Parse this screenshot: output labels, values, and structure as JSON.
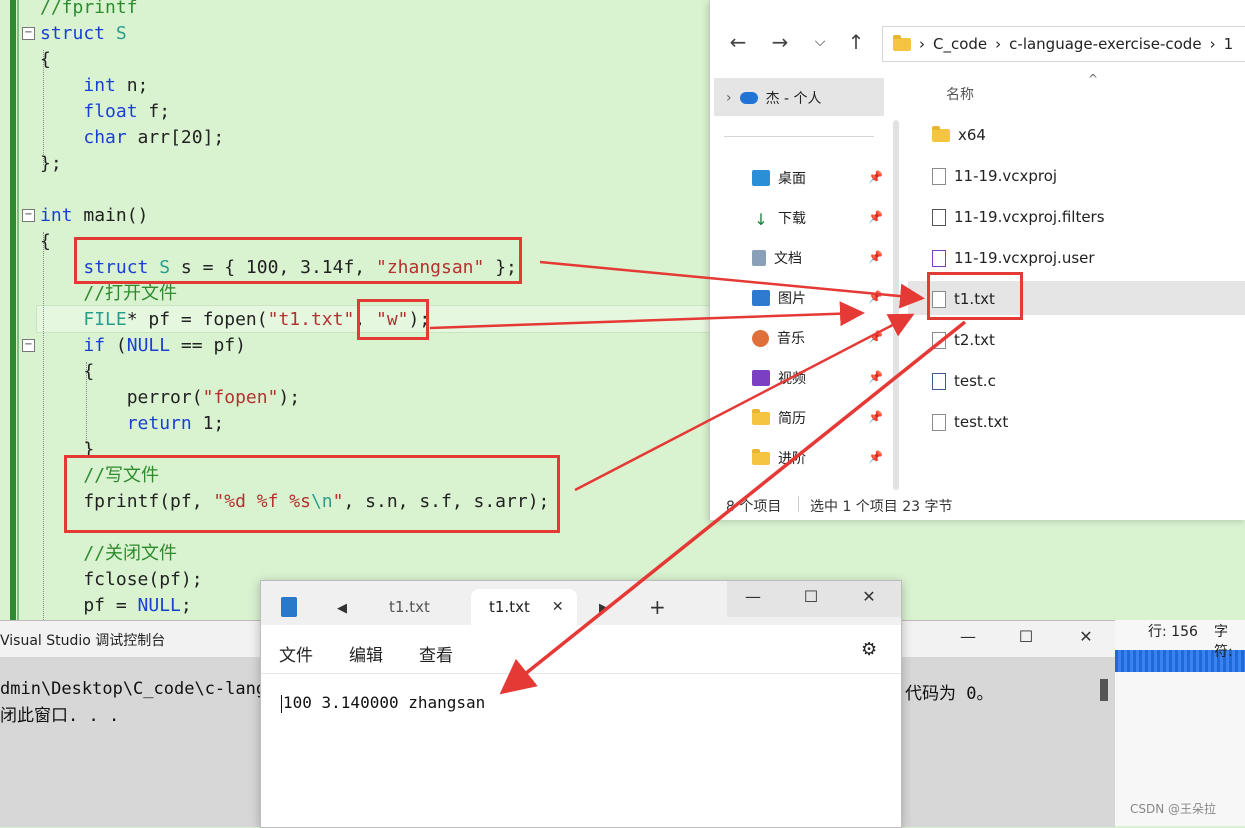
{
  "code": {
    "lines": [
      {
        "parts": [
          {
            "t": "//fprintf",
            "c": "cm"
          }
        ]
      },
      {
        "parts": [
          {
            "t": "struct",
            "c": "kw"
          },
          {
            "t": " S",
            "c": "ty"
          }
        ]
      },
      {
        "parts": [
          {
            "t": "{",
            "c": "nm"
          }
        ]
      },
      {
        "parts": [
          {
            "t": "    ",
            "c": "nm"
          },
          {
            "t": "int",
            "c": "kw"
          },
          {
            "t": " n;",
            "c": "nm"
          }
        ]
      },
      {
        "parts": [
          {
            "t": "    ",
            "c": "nm"
          },
          {
            "t": "float",
            "c": "kw"
          },
          {
            "t": " f;",
            "c": "nm"
          }
        ]
      },
      {
        "parts": [
          {
            "t": "    ",
            "c": "nm"
          },
          {
            "t": "char",
            "c": "kw"
          },
          {
            "t": " arr[20];",
            "c": "nm"
          }
        ]
      },
      {
        "parts": [
          {
            "t": "};",
            "c": "nm"
          }
        ]
      },
      {
        "parts": [
          {
            "t": "",
            "c": "nm"
          }
        ]
      },
      {
        "parts": [
          {
            "t": "int",
            "c": "kw"
          },
          {
            "t": " main()",
            "c": "nm"
          }
        ]
      },
      {
        "parts": [
          {
            "t": "{",
            "c": "nm"
          }
        ]
      },
      {
        "parts": [
          {
            "t": "    ",
            "c": "nm"
          },
          {
            "t": "struct",
            "c": "kw"
          },
          {
            "t": " S",
            "c": "ty"
          },
          {
            "t": " s = { 100, 3.14f, ",
            "c": "nm"
          },
          {
            "t": "\"zhangsan\"",
            "c": "st"
          },
          {
            "t": " };",
            "c": "nm"
          }
        ]
      },
      {
        "parts": [
          {
            "t": "    ",
            "c": "nm"
          },
          {
            "t": "//打开文件",
            "c": "cm"
          }
        ]
      },
      {
        "parts": [
          {
            "t": "    ",
            "c": "nm"
          },
          {
            "t": "FILE",
            "c": "ty"
          },
          {
            "t": "* pf = fopen(",
            "c": "nm"
          },
          {
            "t": "\"t1.txt\"",
            "c": "st"
          },
          {
            "t": ", ",
            "c": "nm"
          },
          {
            "t": "\"w\"",
            "c": "st"
          },
          {
            "t": ");",
            "c": "nm"
          }
        ]
      },
      {
        "parts": [
          {
            "t": "    ",
            "c": "nm"
          },
          {
            "t": "if",
            "c": "kw"
          },
          {
            "t": " (",
            "c": "nm"
          },
          {
            "t": "NULL",
            "c": "kw"
          },
          {
            "t": " == pf)",
            "c": "nm"
          }
        ]
      },
      {
        "parts": [
          {
            "t": "    {",
            "c": "nm"
          }
        ]
      },
      {
        "parts": [
          {
            "t": "        perror(",
            "c": "nm"
          },
          {
            "t": "\"fopen\"",
            "c": "st"
          },
          {
            "t": ");",
            "c": "nm"
          }
        ]
      },
      {
        "parts": [
          {
            "t": "        ",
            "c": "nm"
          },
          {
            "t": "return",
            "c": "kw"
          },
          {
            "t": " 1;",
            "c": "nm"
          }
        ]
      },
      {
        "parts": [
          {
            "t": "    }",
            "c": "nm"
          }
        ]
      },
      {
        "parts": [
          {
            "t": "    ",
            "c": "nm"
          },
          {
            "t": "//写文件",
            "c": "cm"
          }
        ]
      },
      {
        "parts": [
          {
            "t": "    fprintf(pf, ",
            "c": "nm"
          },
          {
            "t": "\"%d %f %s",
            "c": "st"
          },
          {
            "t": "\\n",
            "c": "ty"
          },
          {
            "t": "\"",
            "c": "st"
          },
          {
            "t": ", s.n, s.f, s.arr);",
            "c": "nm"
          }
        ]
      },
      {
        "parts": [
          {
            "t": "",
            "c": "nm"
          }
        ]
      },
      {
        "parts": [
          {
            "t": "    ",
            "c": "nm"
          },
          {
            "t": "//关闭文件",
            "c": "cm"
          }
        ]
      },
      {
        "parts": [
          {
            "t": "    fclose(pf);",
            "c": "nm"
          }
        ]
      },
      {
        "parts": [
          {
            "t": "    pf = ",
            "c": "nm"
          },
          {
            "t": "NULL",
            "c": "kw"
          },
          {
            "t": ";",
            "c": "nm"
          }
        ]
      }
    ]
  },
  "explorer": {
    "path": [
      "C_code",
      "c-language-exercise-code",
      "1"
    ],
    "sidebar_top": "杰 - 个人",
    "sidebar": [
      "桌面",
      "下载",
      "文档",
      "图片",
      "音乐",
      "视频",
      "简历",
      "进阶"
    ],
    "column_header": "名称",
    "files": [
      "x64",
      "11-19.vcxproj",
      "11-19.vcxproj.filters",
      "11-19.vcxproj.user",
      "t1.txt",
      "t2.txt",
      "test.c",
      "test.txt"
    ],
    "status_count": "8 个项目",
    "status_selected": "选中 1 个项目  23 字节",
    "colors": {
      "selection": "#e5e5e5",
      "annotation": "#e53935"
    }
  },
  "console": {
    "title": "Visual Studio 调试控制台",
    "line1": "dmin\\Desktop\\C_code\\c-langu",
    "line1_right": "代码为 0。",
    "line2": "闭此窗口. . ."
  },
  "statusbar": {
    "line": "行: 156",
    "char": "字符:"
  },
  "notepad": {
    "tab1": "t1.txt",
    "tab2": "t1.txt",
    "menu": [
      "文件",
      "编辑",
      "查看"
    ],
    "content": "100 3.140000 zhangsan"
  },
  "watermark": "CSDN @王朵拉"
}
